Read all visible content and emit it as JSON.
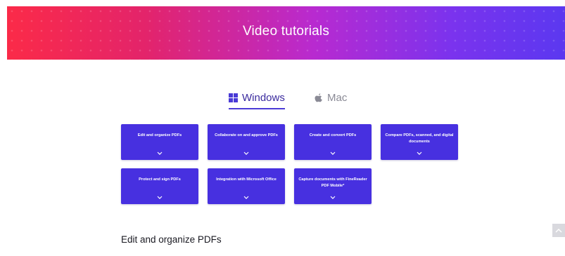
{
  "hero": {
    "title": "Video tutorials"
  },
  "os_tabs": {
    "windows_label": "Windows",
    "mac_label": "Mac",
    "selected": "Windows"
  },
  "cards": [
    {
      "label": "Edit and organize PDFs"
    },
    {
      "label": "Collaborate on and approve PDFs"
    },
    {
      "label": "Create and convert PDFs"
    },
    {
      "label": "Compare PDFs, scanned, and digital documents"
    },
    {
      "label": "Protect and sign PDFs"
    },
    {
      "label": "Integration with Microsoft Office"
    },
    {
      "label": "Capture documents with FineReader PDF Mobile*"
    }
  ],
  "section": {
    "title": "Edit and organize PDFs"
  },
  "colors": {
    "card_bg": "#4730e0",
    "accent": "#4a3bd6",
    "hero_gradient_start": "#fb2a48",
    "hero_gradient_end": "#5b38f0"
  },
  "icons": {
    "windows": "windows-logo-icon",
    "mac": "apple-logo-icon",
    "card_expand": "chevron-down-icon",
    "scroll_top": "chevron-up-icon"
  }
}
